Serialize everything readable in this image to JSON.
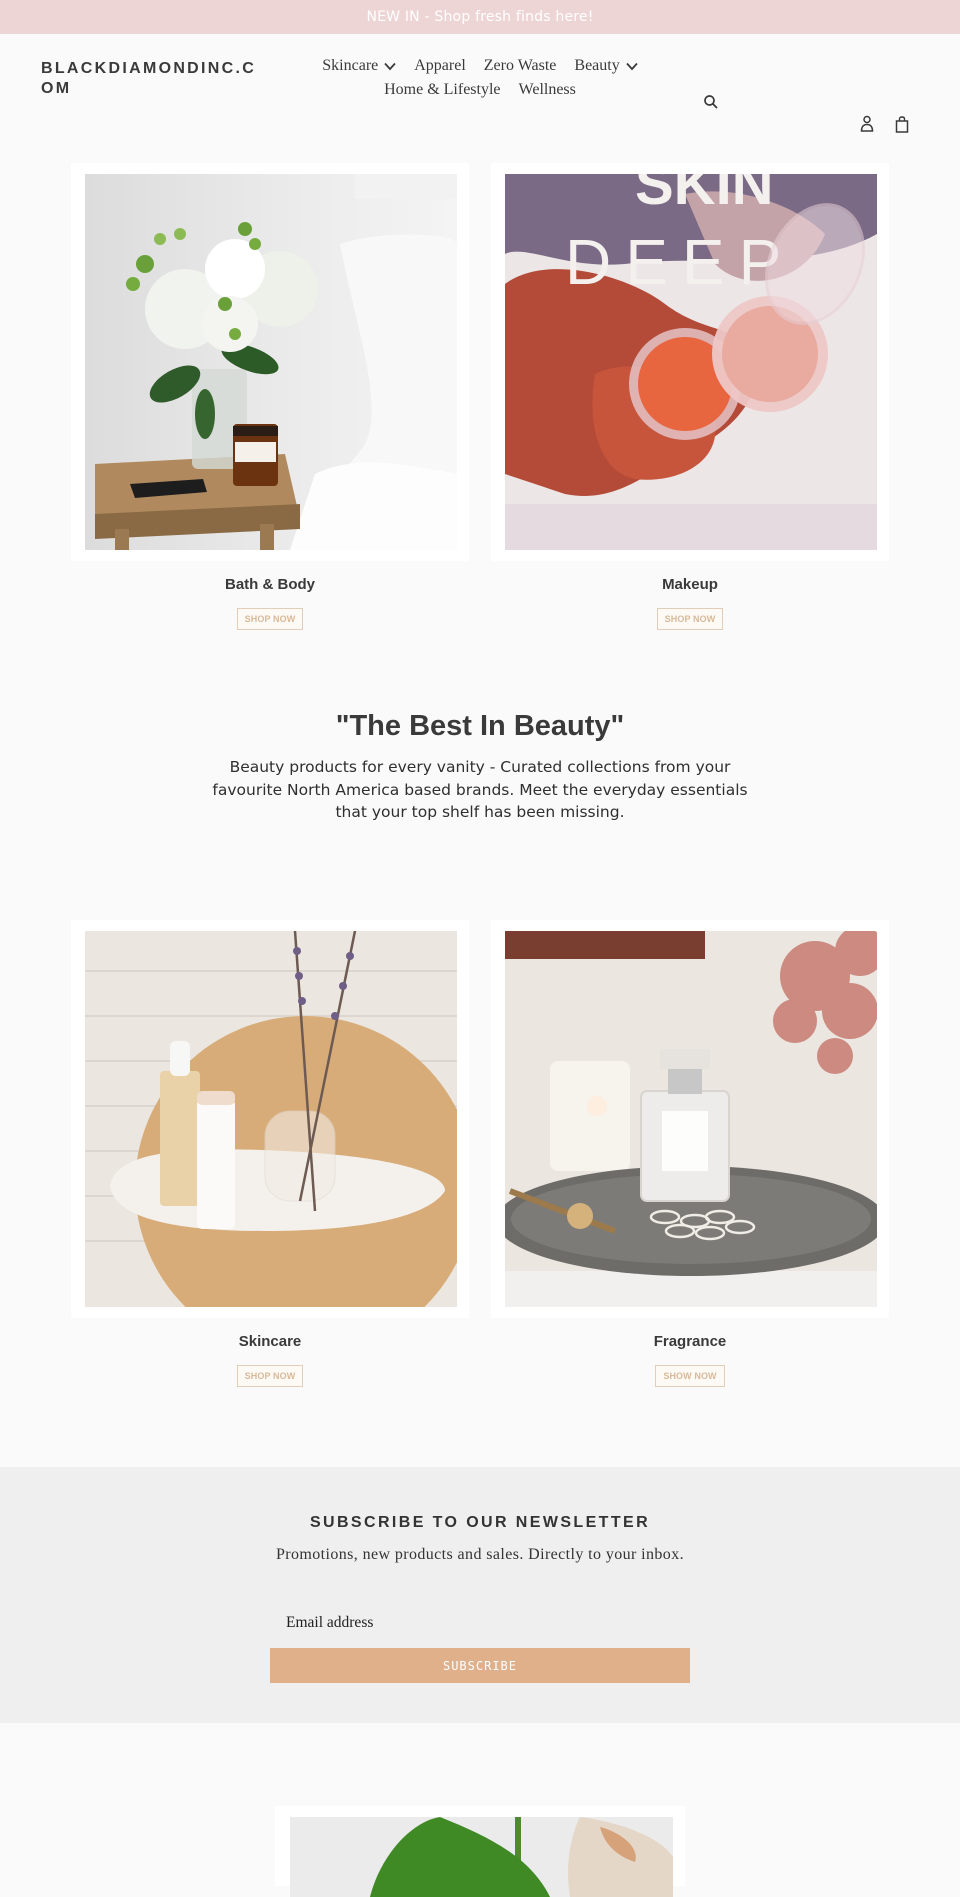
{
  "announcement": {
    "text": "NEW IN - Shop fresh finds here!"
  },
  "header": {
    "logo": "BLACKDIAMONDINC.COM",
    "nav": {
      "row1": [
        {
          "label": "Skincare",
          "has_dropdown": true
        },
        {
          "label": "Apparel",
          "has_dropdown": false
        },
        {
          "label": "Zero Waste",
          "has_dropdown": false
        },
        {
          "label": "Beauty",
          "has_dropdown": true
        }
      ],
      "row2": [
        {
          "label": "Home & Lifestyle",
          "has_dropdown": false
        },
        {
          "label": "Wellness",
          "has_dropdown": false
        }
      ]
    },
    "icons": {
      "search": "search-icon",
      "account": "account-icon",
      "cart": "cart-icon"
    }
  },
  "collections_top": [
    {
      "title": "Bath & Body",
      "button": "SHOP NOW",
      "image": "flowers-bedside-table"
    },
    {
      "title": "Makeup",
      "button": "SHOP NOW",
      "image": "blush-compacts-skin-deep"
    }
  ],
  "intro": {
    "heading": "\"The Best In Beauty\"",
    "body": "Beauty products for every vanity - Curated collections from your favourite North America based brands. Meet the everyday essentials that your top shelf has been missing."
  },
  "collections_bottom": [
    {
      "title": "Skincare",
      "button": "SHOP NOW",
      "image": "honest-beauty-shelf-lavender"
    },
    {
      "title": "Fragrance",
      "button": "SHOW NOW",
      "image": "perfume-tray-watch"
    }
  ],
  "newsletter": {
    "heading": "SUBSCRIBE TO OUR NEWSLETTER",
    "subtext": "Promotions, new products and sales. Directly to your inbox.",
    "email_placeholder": "Email address",
    "button": "SUBSCRIBE"
  },
  "colors": {
    "announcement_bg": "#edd5d5",
    "accent": "#e0b08b",
    "button_outline": "#e2cdb8",
    "newsletter_bg": "#efefef",
    "page_bg": "#fafafa"
  }
}
